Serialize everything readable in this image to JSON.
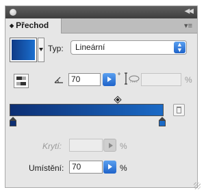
{
  "panel": {
    "tab_label": "Přechod",
    "tab_arrows": "◆"
  },
  "gradient": {
    "type_label": "Typ:",
    "type_value": "Lineární",
    "angle_value": "70",
    "angle_unit": "°",
    "aspect_unit": "%",
    "start_color": "#0d2f73",
    "end_color": "#1b6ac6"
  },
  "stops": {
    "opacity_label": "Krytí:",
    "opacity_value": "",
    "opacity_unit": "%",
    "location_label": "Umístění:",
    "location_value": "70",
    "location_unit": "%"
  },
  "icons": {
    "close": "close-dot-icon",
    "collapse": "collapse-double-arrow-icon",
    "menu": "panel-menu-icon",
    "reverse": "reverse-gradient-icon",
    "angle": "angle-icon",
    "aspect": "aspect-ratio-icon",
    "midpoint": "midpoint-diamond-icon",
    "delete": "trash-icon"
  }
}
